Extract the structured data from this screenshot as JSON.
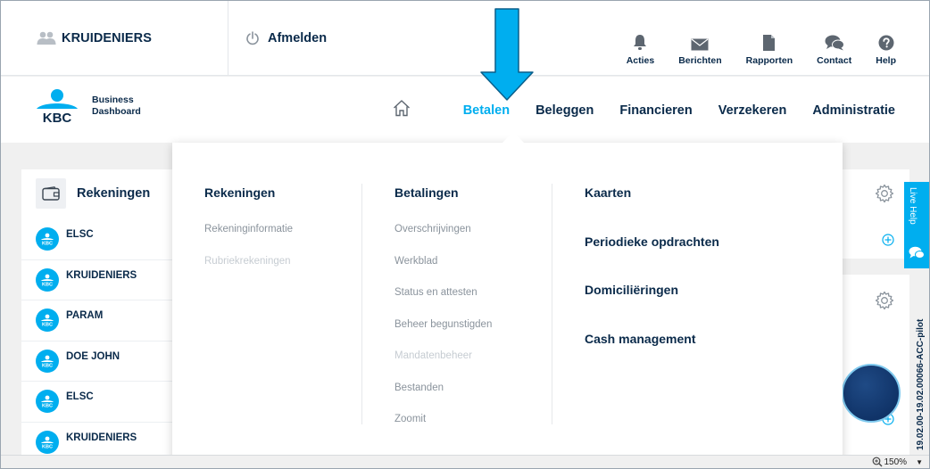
{
  "topbar": {
    "user_name": "KRUIDENIERS",
    "logout_label": "Afmelden",
    "actions": [
      {
        "label": "Acties",
        "icon": "bell-icon"
      },
      {
        "label": "Berichten",
        "icon": "envelope-icon"
      },
      {
        "label": "Rapporten",
        "icon": "document-icon"
      },
      {
        "label": "Contact",
        "icon": "chat-bubbles-icon"
      },
      {
        "label": "Help",
        "icon": "question-circle-icon"
      }
    ]
  },
  "brand": {
    "logo_text": "KBC",
    "tagline_line1": "Business",
    "tagline_line2": "Dashboard"
  },
  "nav": {
    "items": [
      "Betalen",
      "Beleggen",
      "Financieren",
      "Verzekeren",
      "Administratie"
    ],
    "active": "Betalen"
  },
  "accounts": {
    "title": "Rekeningen",
    "items": [
      "ELSC",
      "KRUIDENIERS",
      "PARAM",
      "DOE JOHN",
      "ELSC",
      "KRUIDENIERS"
    ]
  },
  "mega_menu": {
    "col1": {
      "heading": "Rekeningen",
      "links": [
        {
          "label": "Rekeninginformatie",
          "disabled": false
        },
        {
          "label": "Rubriekrekeningen",
          "disabled": true
        }
      ]
    },
    "col2": {
      "heading": "Betalingen",
      "links": [
        {
          "label": "Overschrijvingen",
          "disabled": false
        },
        {
          "label": "Werkblad",
          "disabled": false
        },
        {
          "label": "Status en attesten",
          "disabled": false
        },
        {
          "label": "Beheer begunstigden",
          "disabled": false
        },
        {
          "label": "Mandatenbeheer",
          "disabled": true
        },
        {
          "label": "Bestanden",
          "disabled": false
        },
        {
          "label": "Zoomit",
          "disabled": false
        }
      ]
    },
    "col3": {
      "items": [
        "Kaarten",
        "Periodieke opdrachten",
        "Domiciliëringen",
        "Cash management"
      ]
    }
  },
  "live_help": {
    "label": "Live Help"
  },
  "env_label": "19.02.00-19.02.00066-ACC-pilot",
  "statusbar": {
    "zoom": "150%"
  },
  "colors": {
    "navy": "#0a2a4a",
    "accent": "#00aeef",
    "muted": "#8a939c",
    "disabled": "#c6ccd2"
  }
}
